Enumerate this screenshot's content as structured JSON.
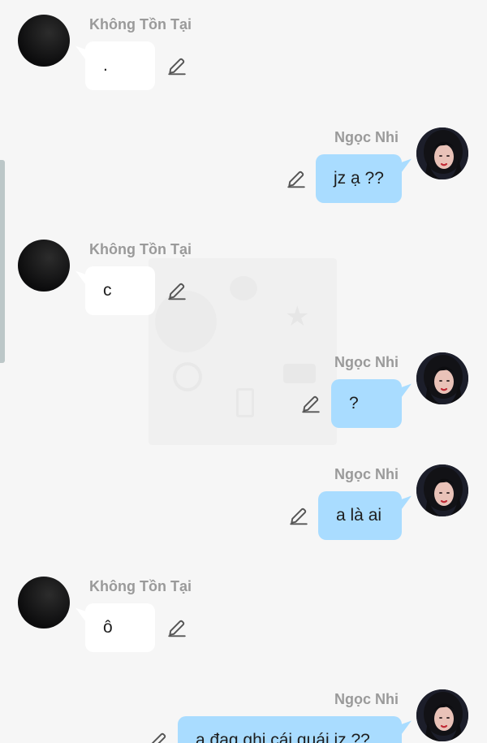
{
  "messages": [
    {
      "sender": "Không Tồn Tại",
      "side": "in",
      "text": "."
    },
    {
      "sender": "Ngọc Nhi",
      "side": "out",
      "text": "jz ạ ??"
    },
    {
      "sender": "Không Tồn Tại",
      "side": "in",
      "text": "c"
    },
    {
      "sender": "Ngọc Nhi",
      "side": "out",
      "text": "?"
    },
    {
      "sender": "Ngọc Nhi",
      "side": "out",
      "text": "a là ai"
    },
    {
      "sender": "Không Tồn Tại",
      "side": "in",
      "text": "ô"
    },
    {
      "sender": "Ngọc Nhi",
      "side": "out",
      "text": "a đag ghi cái quái jz ??"
    }
  ],
  "icons": {
    "edit": "edit-pencil-icon",
    "avatar_in": "dark-avatar",
    "avatar_out": "photo-avatar"
  },
  "colors": {
    "background": "#f6f6f6",
    "incoming_bubble": "#ffffff",
    "outgoing_bubble": "#a9dcff",
    "sender_name": "#9a9a9a",
    "text": "#1d1d1d",
    "scroll_edge": "#bcc7c8"
  }
}
